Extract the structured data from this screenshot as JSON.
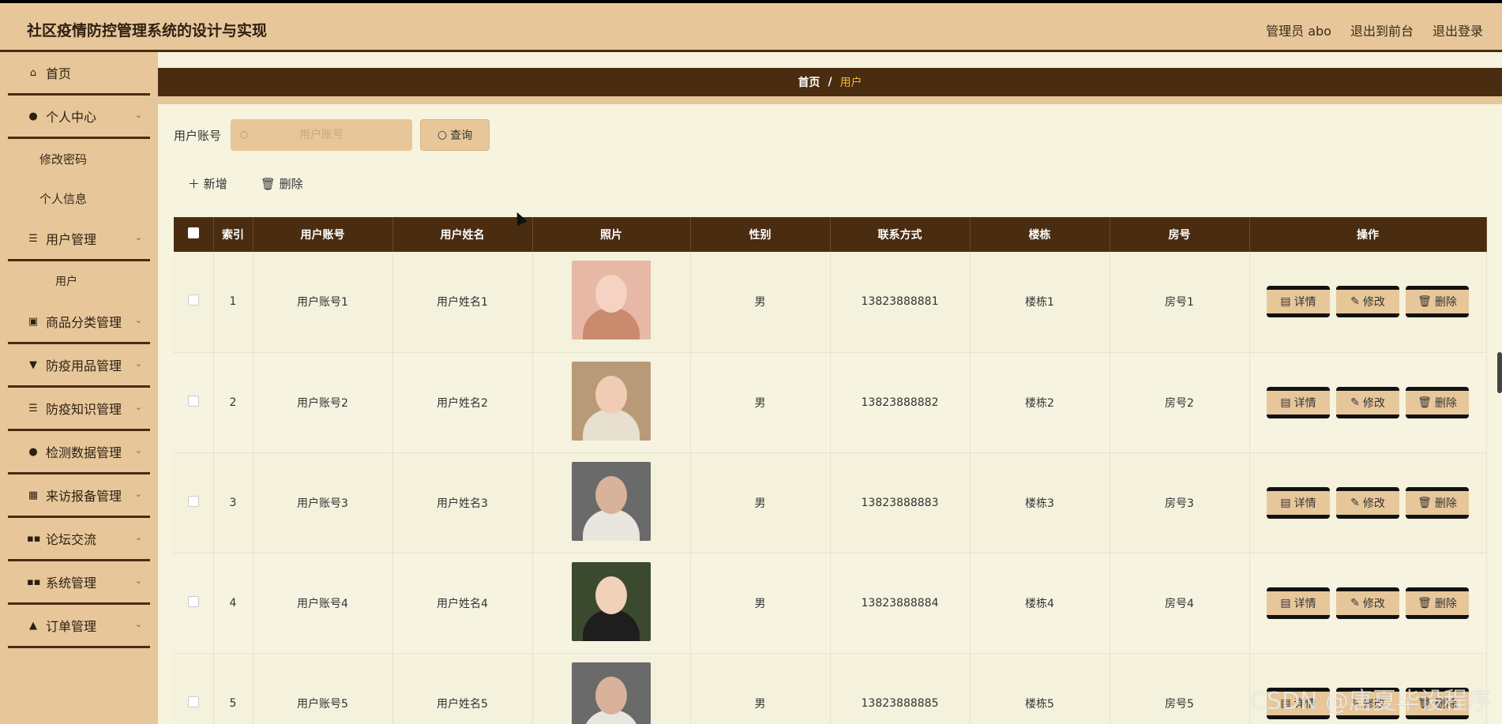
{
  "header": {
    "title": "社区疫情防控管理系统的设计与实现",
    "admin": "管理员 abo",
    "to_front": "退出到前台",
    "logout": "退出登录"
  },
  "sidebar": {
    "items": [
      {
        "label": "首页",
        "icon": "home-icon",
        "type": "item"
      },
      {
        "label": "个人中心",
        "icon": "user-icon",
        "type": "group"
      },
      {
        "label": "修改密码",
        "type": "sub"
      },
      {
        "label": "个人信息",
        "type": "sub"
      },
      {
        "label": "用户管理",
        "icon": "list-icon",
        "type": "group"
      },
      {
        "label": "用户",
        "type": "deep"
      },
      {
        "label": "商品分类管理",
        "icon": "clipboard-icon",
        "type": "group"
      },
      {
        "label": "防疫用品管理",
        "icon": "stamp-icon",
        "type": "group"
      },
      {
        "label": "防疫知识管理",
        "icon": "list-icon",
        "type": "group"
      },
      {
        "label": "检测数据管理",
        "icon": "user-icon",
        "type": "group"
      },
      {
        "label": "来访报备管理",
        "icon": "grid-icon",
        "type": "group"
      },
      {
        "label": "论坛交流",
        "icon": "apps-icon",
        "type": "group"
      },
      {
        "label": "系统管理",
        "icon": "apps-icon",
        "type": "group"
      },
      {
        "label": "订单管理",
        "icon": "thumb-icon",
        "type": "group"
      }
    ]
  },
  "breadcrumb": {
    "home": "首页",
    "sep": "/",
    "current": "用户"
  },
  "search": {
    "label": "用户账号",
    "placeholder": "用户账号",
    "query_btn": "查询"
  },
  "toolbar": {
    "add": "新增",
    "delete": "删除"
  },
  "table": {
    "headers": [
      "索引",
      "用户账号",
      "用户姓名",
      "照片",
      "性别",
      "联系方式",
      "楼栋",
      "房号",
      "操作"
    ],
    "rows": [
      {
        "index": "1",
        "account": "用户账号1",
        "name": "用户姓名1",
        "gender": "男",
        "phone": "13823888881",
        "building": "楼栋1",
        "room": "房号1"
      },
      {
        "index": "2",
        "account": "用户账号2",
        "name": "用户姓名2",
        "gender": "男",
        "phone": "13823888882",
        "building": "楼栋2",
        "room": "房号2"
      },
      {
        "index": "3",
        "account": "用户账号3",
        "name": "用户姓名3",
        "gender": "男",
        "phone": "13823888883",
        "building": "楼栋3",
        "room": "房号3"
      },
      {
        "index": "4",
        "account": "用户账号4",
        "name": "用户姓名4",
        "gender": "男",
        "phone": "13823888884",
        "building": "楼栋4",
        "room": "房号4"
      },
      {
        "index": "5",
        "account": "用户账号5",
        "name": "用户姓名5",
        "gender": "男",
        "phone": "13823888885",
        "building": "楼栋5",
        "room": "房号5"
      }
    ],
    "ops": {
      "detail": "详情",
      "edit": "修改",
      "delete": "删除"
    }
  },
  "watermark": "CSDN @唐夏毕设程序",
  "colors": {
    "primary": "#4a2c10",
    "secondary": "#e7c79a",
    "background": "#f6f3de",
    "accent": "#f0b93a"
  }
}
